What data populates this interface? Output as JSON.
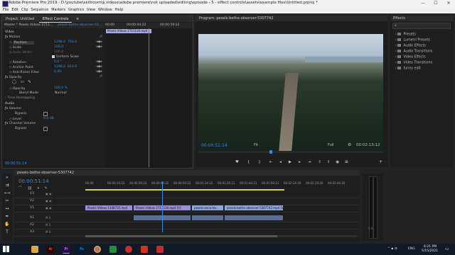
{
  "window": {
    "title": "Adobe Premiere Pro 2019 - D:\\youtube\\skillroom\\$ videos\\adobe premiere\\not uploaded\\editing\\episode - 5 - effect controls\\assets\\example files\\Untitled.prproj *",
    "minimize": "—",
    "maximize": "☐",
    "close": "✕"
  },
  "menu": [
    "File",
    "Edit",
    "Clip",
    "Sequence",
    "Markers",
    "Graphics",
    "View",
    "Window",
    "Help"
  ],
  "left_panel": {
    "tabs": [
      "Project: Untitled",
      "Effect Controls"
    ],
    "menu_icon": "≡",
    "clip_selector": "Master * Pexels Videos 2711...",
    "sequence_name": "pexels-bethe-observer-53...",
    "clip_label": "Pexels Videos 2711134.mp4",
    "timecodes": [
      "00:00",
      "00:00:44:22",
      "00:00:59:22"
    ],
    "current_time": "00:00:51:14",
    "section_video": "Video",
    "motion": {
      "label": "Motion",
      "position": {
        "label": "Position",
        "x": "1296.0",
        "y": "750.0"
      },
      "scale": {
        "label": "Scale",
        "value": "100.0"
      },
      "scale_width": {
        "label": "Scale Width",
        "value": "100.0"
      },
      "uniform_scale": "Uniform Scale",
      "rotation": {
        "label": "Rotation",
        "value": "0.0 °"
      },
      "anchor_point": {
        "label": "Anchor Point",
        "x": "1296.0",
        "y": "810.0"
      },
      "anti_flicker": {
        "label": "Anti-flicker Filter",
        "value": "0.00"
      }
    },
    "opacity": {
      "label": "Opacity",
      "value_label": "Opacity",
      "value": "100.0 %",
      "blend_label": "Blend Mode",
      "blend_value": "Normal"
    },
    "time_remapping": "Time Remapping",
    "section_audio": "Audio",
    "volume": {
      "label": "Volume",
      "bypass": "Bypass",
      "level_label": "Level",
      "level_value": "0.0 dB"
    },
    "channel_volume": {
      "label": "Channel Volume",
      "bypass": "Bypass"
    }
  },
  "program": {
    "title": "Program: pexels-bethe-observer-5307742",
    "timecode": "00:00:51:14",
    "fit": "Fit",
    "quality": "Full",
    "duration": "00:02:13:12"
  },
  "effects_panel": {
    "title": "Effects",
    "items": [
      "Presets",
      "Lumetri Presets",
      "Audio Effects",
      "Audio Transitions",
      "Video Effects",
      "Video Transitions",
      "funny edit"
    ]
  },
  "timeline": {
    "sequence_name": "pexels-bethe-observer-5307742",
    "timecode": "00:00:51:14",
    "ruler": [
      "00:00",
      "00:00:14:23",
      "00:00:29:23",
      "00:00:44:22",
      "00:00:59:22",
      "00:01:14:22",
      "00:01:29:21",
      "00:01:44:21",
      "00:01:59:21",
      "00:02:14:20",
      "00:02:29:20",
      "00:02:44:20"
    ],
    "track_labels": [
      "V3",
      "V2",
      "V1",
      "A1",
      "A2",
      "A3"
    ],
    "clips": [
      "Pexels Videos 1448735.mp4",
      "Pexels Videos 2711134.mp4 [V]",
      "pexels-anna-tar...",
      "pexels-bethe-observer-5307742.mp4 [V]"
    ]
  },
  "taskbar": {
    "time": "6:21 PM",
    "date": "5/15/2021",
    "language": "ENG"
  },
  "colors": {
    "accent": "#2d8ceb",
    "playhead": "#2d8ceb",
    "clip_purple": "#9b8fd6",
    "clip_blue": "#8fa6d9",
    "clip_yellow": "#d8d24a"
  }
}
